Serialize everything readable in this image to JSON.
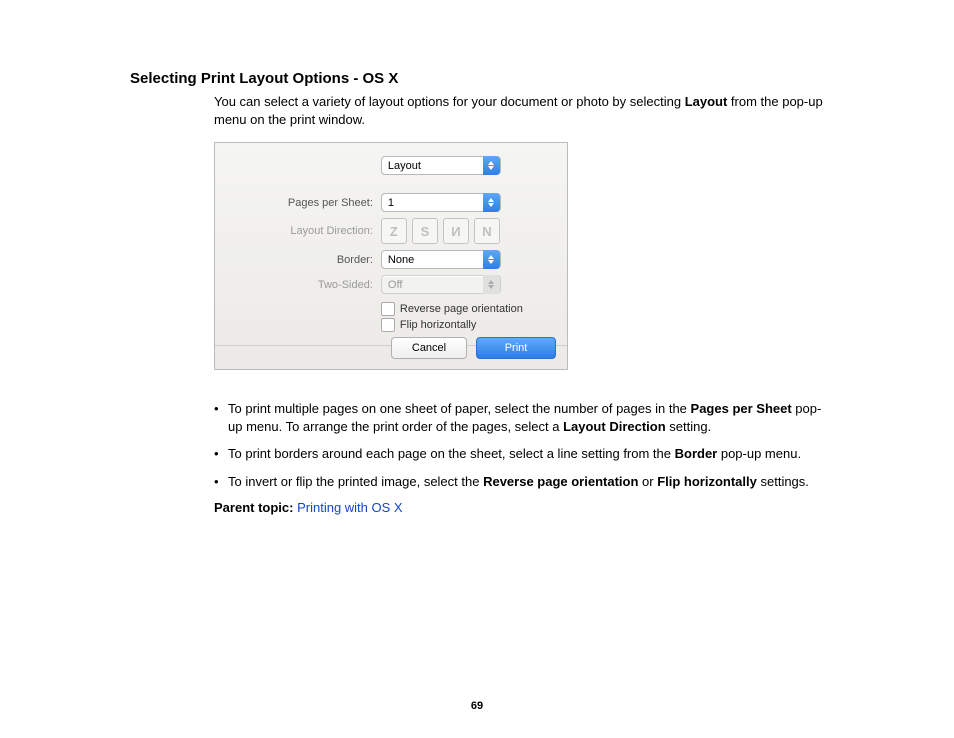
{
  "heading": "Selecting Print Layout Options - OS X",
  "intro_part1": "You can select a variety of layout options for your document or photo by selecting ",
  "intro_bold": "Layout",
  "intro_part2": " from the pop-up menu on the print window.",
  "dialog": {
    "panel_select": "Layout",
    "rows": {
      "pages_label": "Pages per Sheet:",
      "pages_value": "1",
      "direction_label": "Layout Direction:",
      "direction_opts": [
        "Z",
        "S",
        "И",
        "N"
      ],
      "border_label": "Border:",
      "border_value": "None",
      "twosided_label": "Two-Sided:",
      "twosided_value": "Off",
      "reverse_label": "Reverse page orientation",
      "flip_label": "Flip horizontally"
    },
    "cancel": "Cancel",
    "print": "Print"
  },
  "bullets": {
    "b1_a": "To print multiple pages on one sheet of paper, select the number of pages in the ",
    "b1_bold1": "Pages per Sheet",
    "b1_b": " pop-up menu. To arrange the print order of the pages, select a ",
    "b1_bold2": "Layout Direction",
    "b1_c": " setting.",
    "b2_a": "To print borders around each page on the sheet, select a line setting from the ",
    "b2_bold": "Border",
    "b2_b": " pop-up menu.",
    "b3_a": "To invert or flip the printed image, select the ",
    "b3_bold1": "Reverse page orientation",
    "b3_b": " or ",
    "b3_bold2": "Flip horizontally",
    "b3_c": " settings."
  },
  "parent_label": "Parent topic:",
  "parent_link": "Printing with OS X",
  "page_number": "69"
}
